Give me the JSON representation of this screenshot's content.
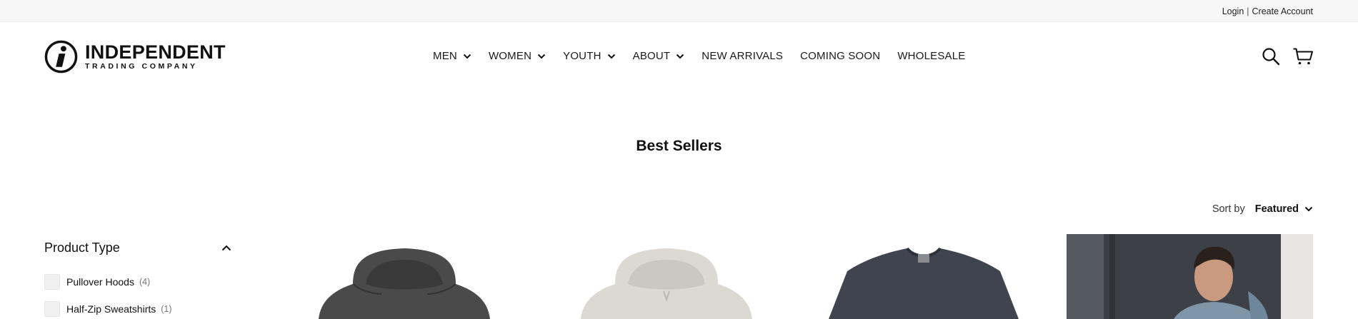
{
  "topbar": {
    "login": "Login",
    "separator": "|",
    "create_account": "Create Account"
  },
  "brand": {
    "name": "INDEPENDENT",
    "tagline": "TRADING COMPANY",
    "logo_icon": "i-circle-logo"
  },
  "nav": {
    "items": [
      {
        "label": "MEN",
        "has_dropdown": true
      },
      {
        "label": "WOMEN",
        "has_dropdown": true
      },
      {
        "label": "YOUTH",
        "has_dropdown": true
      },
      {
        "label": "ABOUT",
        "has_dropdown": true
      },
      {
        "label": "NEW ARRIVALS",
        "has_dropdown": false
      },
      {
        "label": "COMING SOON",
        "has_dropdown": false
      },
      {
        "label": "WHOLESALE",
        "has_dropdown": false
      }
    ]
  },
  "header_icons": [
    "search-icon",
    "cart-icon"
  ],
  "page": {
    "title": "Best Sellers"
  },
  "sort": {
    "label": "Sort by",
    "value": "Featured"
  },
  "filters": {
    "title": "Product Type",
    "expanded": true,
    "options": [
      {
        "label": "Pullover Hoods",
        "count": "(4)"
      },
      {
        "label": "Half-Zip Sweatshirts",
        "count": "(1)"
      }
    ]
  },
  "products": [
    {
      "image": "charcoal-hoodie",
      "color": "#4a4a4a"
    },
    {
      "image": "bone-hoodie",
      "color": "#d8d5cf"
    },
    {
      "image": "navy-tshirt",
      "color": "#40444f"
    },
    {
      "image": "model-in-blue-hoodie",
      "color": "#7f96a8"
    }
  ]
}
